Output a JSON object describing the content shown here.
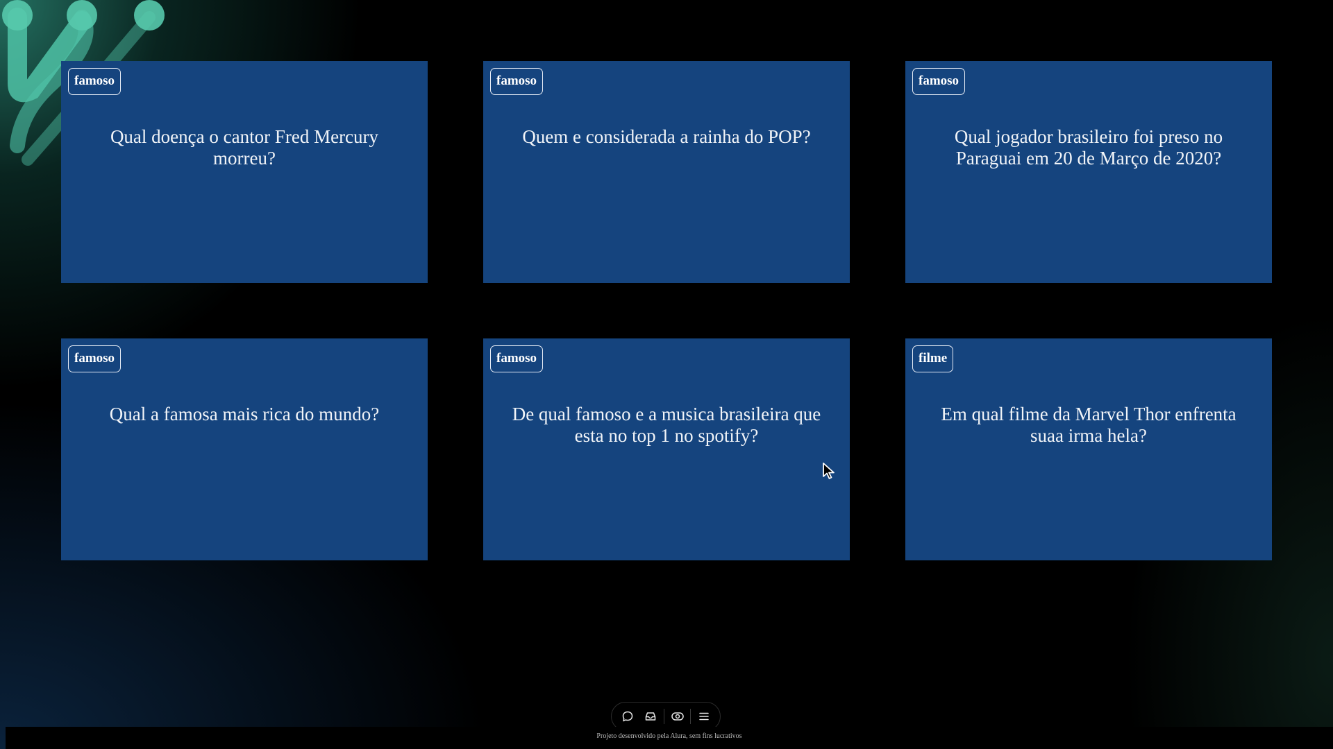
{
  "cards": [
    {
      "tag": "famoso",
      "question": "Qual doença o cantor Fred Mercury morreu?"
    },
    {
      "tag": "famoso",
      "question": "Quem e considerada a rainha do POP?"
    },
    {
      "tag": "famoso",
      "question": "Qual jogador brasileiro foi preso no Paraguai em 20 de Março de 2020?"
    },
    {
      "tag": "famoso",
      "question": "Qual a famosa mais rica do mundo?"
    },
    {
      "tag": "famoso",
      "question": "De qual famoso e a musica brasileira que esta no top 1 no spotify?"
    },
    {
      "tag": "filme",
      "question": "Em qual filme da Marvel Thor enfrenta suaa irma hela?"
    }
  ],
  "toolbar": {
    "icons": [
      "chat-bubble-icon",
      "inbox-icon",
      "eye-toggle-icon",
      "menu-icon"
    ]
  },
  "footer": {
    "text": "Projeto desenvolvido pela Alura, sem fins lucrativos"
  },
  "colors": {
    "card_background": "#15447e",
    "page_background": "#000000",
    "accent_teal": "#3fb89e"
  }
}
